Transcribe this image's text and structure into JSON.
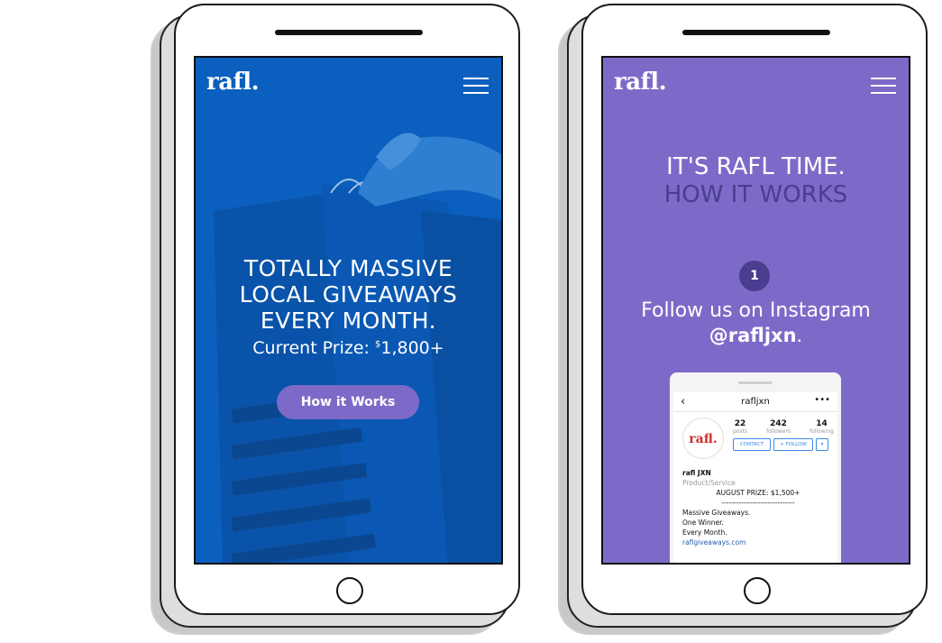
{
  "left_phone": {
    "logo": "rafl.",
    "hero": {
      "line1": "TOTALLY MASSIVE",
      "line2": "LOCAL GIVEAWAYS",
      "line3": "EVERY MONTH."
    },
    "prize_label": "Current Prize: ",
    "prize_currency": "$",
    "prize_value": "1,800+",
    "cta_label": "How it Works"
  },
  "right_phone": {
    "logo": "rafl.",
    "title": "IT'S RAFL TIME.",
    "subtitle": "HOW IT WORKS",
    "step_number": "1",
    "step_text": "Follow us on Instagram",
    "handle": "@rafljxn",
    "handle_suffix": ".",
    "instagram": {
      "username": "rafljxn",
      "back_icon": "‹",
      "more_icon": "•••",
      "avatar_text": "rafl.",
      "stats": [
        {
          "value": "22",
          "label": "posts"
        },
        {
          "value": "242",
          "label": "followers"
        },
        {
          "value": "14",
          "label": "following"
        }
      ],
      "contact_label": "CONTACT",
      "follow_label": "+ FOLLOW",
      "dropdown_icon": "▾",
      "bio_name": "rafl JXN",
      "bio_category": "Product/Service",
      "bio_prize": "AUGUST PRIZE: $1,500+",
      "bio_divider": "------------------------------",
      "bio_line1": "Massive Giveaways.",
      "bio_line2": "One Winner.",
      "bio_line3": "Every Month.",
      "bio_link": "raflgiveaways.com"
    }
  },
  "colors": {
    "left_screen": "#0b5fbf",
    "right_screen": "#7d6ac8",
    "accent": "#4a3d8f",
    "cta": "#7d6ac8"
  }
}
